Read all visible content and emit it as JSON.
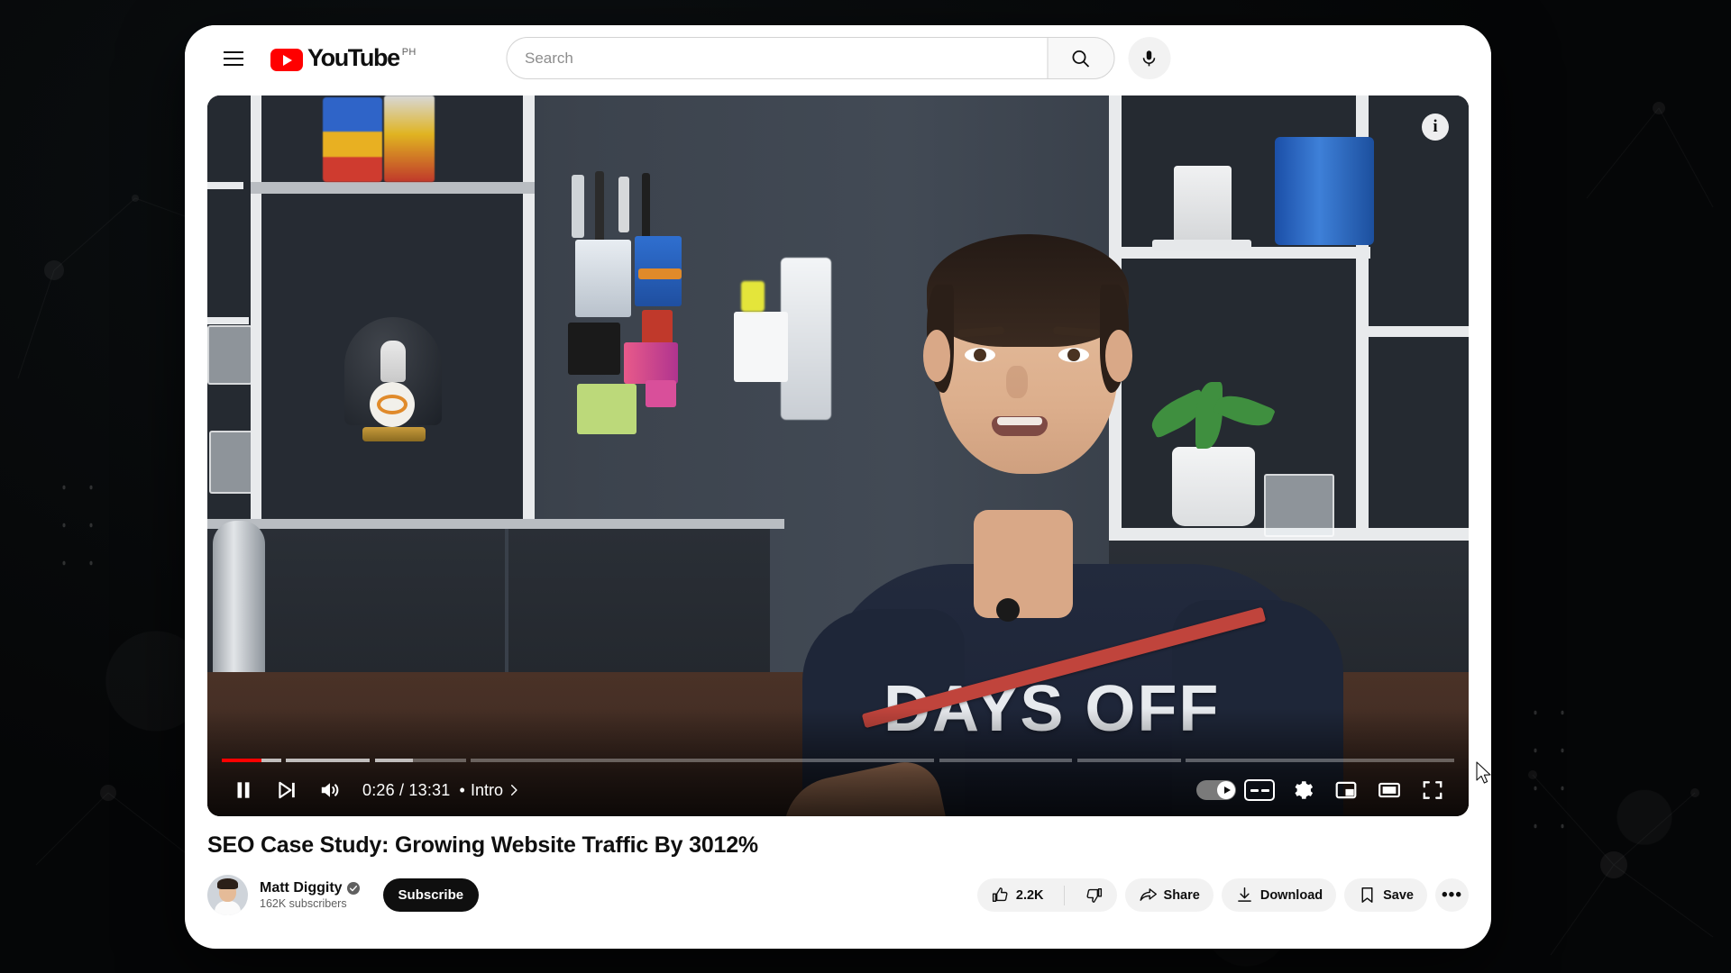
{
  "masthead": {
    "menu_icon": "hamburger-menu-icon",
    "logo_text": "YouTube",
    "logo_country_code": "PH",
    "search_placeholder": "Search",
    "search_value": "",
    "search_icon": "search-icon",
    "mic_icon": "microphone-icon"
  },
  "player": {
    "info_icon": "info-icon",
    "pause_icon": "pause-icon",
    "next_icon": "next-track-icon",
    "volume_icon": "volume-on-icon",
    "time_text": "0:26 / 13:31",
    "chapter_separator": "•",
    "chapter_label": "Intro",
    "chapter_chevron": "chevron-right-icon",
    "autoplay_icon": "autoplay-toggle",
    "subtitles_icon": "closed-captions-icon",
    "settings_icon": "gear-icon",
    "miniplayer_icon": "miniplayer-icon",
    "theater_icon": "theater-mode-icon",
    "fullscreen_icon": "fullscreen-icon",
    "progress": {
      "current_seconds": 26,
      "total_seconds": 811,
      "played_fraction": 0.032,
      "loaded_fraction": 0.155,
      "accent_color": "#ff0000",
      "chapters": [
        {
          "start": 0.0,
          "end": 0.048
        },
        {
          "start": 0.052,
          "end": 0.12
        },
        {
          "start": 0.124,
          "end": 0.198
        },
        {
          "start": 0.202,
          "end": 0.578
        },
        {
          "start": 0.582,
          "end": 0.69
        },
        {
          "start": 0.694,
          "end": 0.778
        },
        {
          "start": 0.782,
          "end": 1.0
        }
      ]
    },
    "scene": {
      "shirt_text": "DAYS OFF",
      "shirt_strike_color": "#c0443c"
    }
  },
  "video": {
    "title": "SEO Case Study: Growing Website Traffic By 3012%",
    "channel_name": "Matt Diggity",
    "channel_verified": true,
    "subscriber_count": "162K subscribers",
    "subscribe_label": "Subscribe",
    "actions": {
      "like_count": "2.2K",
      "like_icon": "thumbs-up-icon",
      "dislike_icon": "thumbs-down-icon",
      "share_label": "Share",
      "share_icon": "share-arrow-icon",
      "download_label": "Download",
      "download_icon": "download-icon",
      "save_label": "Save",
      "save_icon": "bookmark-icon",
      "more_label": "•••",
      "more_icon": "more-horizontal-icon"
    }
  }
}
